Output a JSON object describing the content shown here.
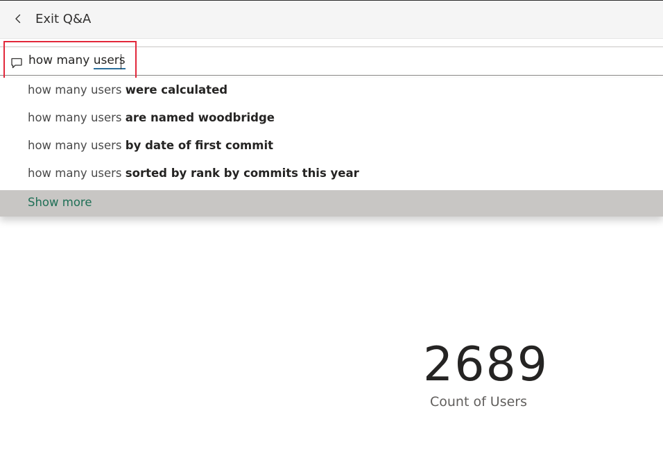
{
  "header": {
    "back_icon": "chevron-left-icon",
    "title": "Exit Q&A"
  },
  "search": {
    "icon": "chat-bubble-icon",
    "query_prefix": "how many ",
    "query_term": "users"
  },
  "suggestions": [
    {
      "prefix": "how many users ",
      "suffix": "were calculated"
    },
    {
      "prefix": "how many users ",
      "suffix": "are named woodbridge"
    },
    {
      "prefix": "how many users ",
      "suffix": "by date of first commit"
    },
    {
      "prefix": "how many users ",
      "suffix": "sorted by rank by commits this year"
    }
  ],
  "show_more_label": "Show more",
  "kpi": {
    "value": "2689",
    "label": "Count of Users"
  },
  "colors": {
    "highlight": "#e2273a",
    "show_more_text": "#1f6f56",
    "show_more_bg": "#c8c6c4",
    "underline": "#2a6e9b"
  }
}
